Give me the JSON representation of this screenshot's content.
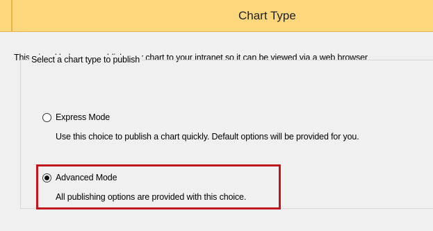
{
  "dialog": {
    "title": "Chart Type",
    "intro": "This wizard helps you publish your chart to your intranet so it can be viewed via a web browser",
    "group": {
      "legend": "Select a chart type to publish",
      "options": [
        {
          "label": "Express Mode",
          "description": "Use this choice to publish a chart quickly.  Default options will be provided for you.",
          "selected": false
        },
        {
          "label": "Advanced Mode",
          "description": "All publishing options are provided with this choice.",
          "selected": true
        }
      ]
    }
  },
  "colors": {
    "title_bar": "#ffd87d",
    "highlight": "#c0161d",
    "background": "#f0f0f0"
  }
}
